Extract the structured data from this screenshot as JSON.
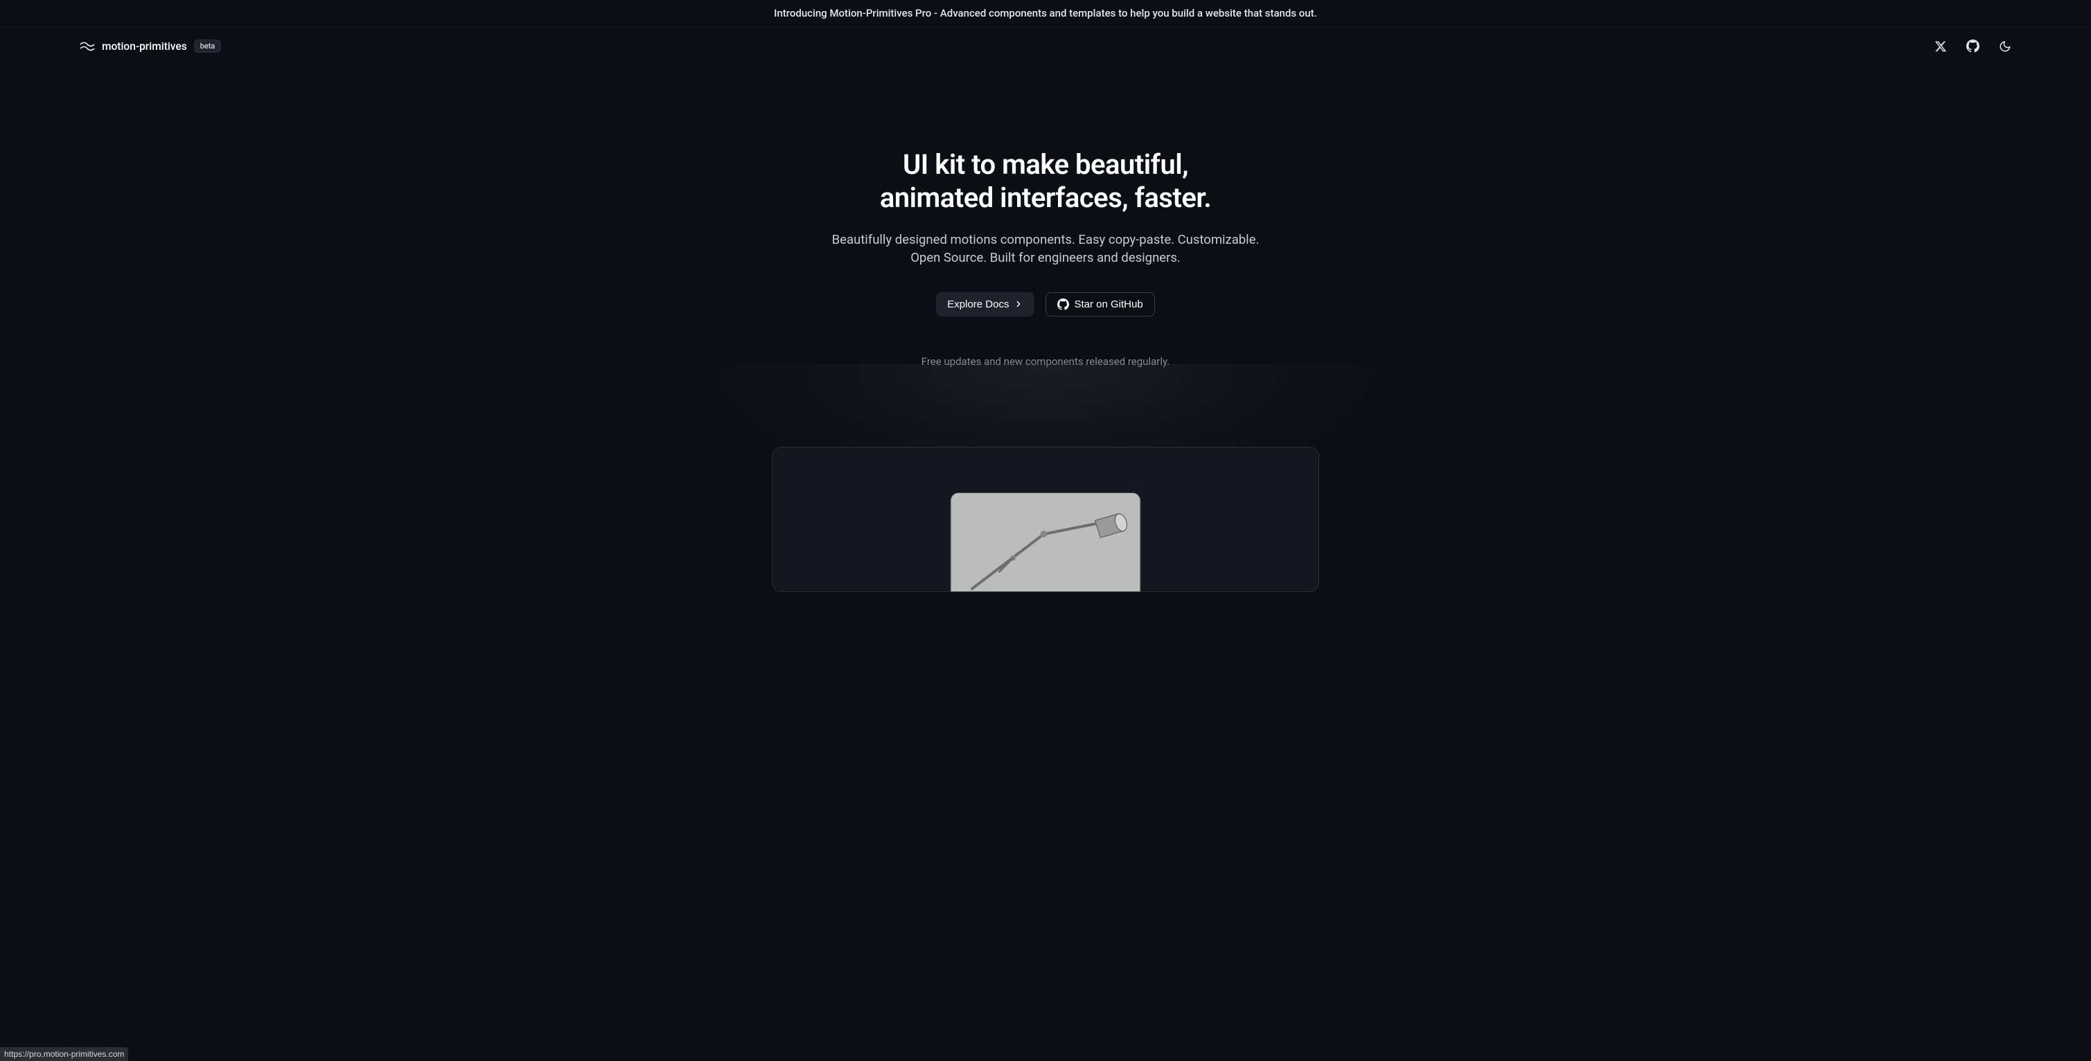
{
  "banner": {
    "text": "Introducing Motion-Primitives Pro - Advanced components and templates to help you build a website that stands out."
  },
  "navbar": {
    "logo_text": "motion-primitives",
    "badge": "beta"
  },
  "hero": {
    "title_line1": "UI kit to make beautiful,",
    "title_line2": "animated interfaces, faster.",
    "subtitle": "Beautifully designed motions components. Easy copy-paste. Customizable. Open Source. Built for engineers and designers.",
    "explore_label": "Explore Docs",
    "star_label": "Star on GitHub",
    "note": "Free updates and new components released regularly."
  },
  "status": {
    "url": "https://pro.motion-primitives.com"
  }
}
